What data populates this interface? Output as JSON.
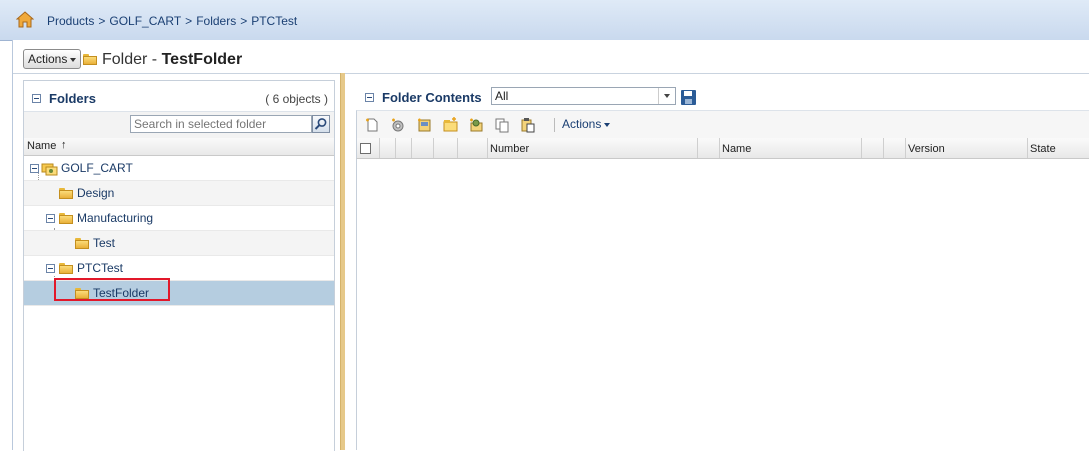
{
  "breadcrumb": {
    "items": [
      "Products",
      "GOLF_CART",
      "Folders",
      "PTCTest"
    ],
    "separator": ">"
  },
  "page_header": {
    "actions_label": "Actions",
    "title_prefix": "Folder - ",
    "title_name": "TestFolder"
  },
  "folders_panel": {
    "title": "Folders",
    "count": "( 6 objects )",
    "search_placeholder": "Search in selected folder",
    "column_name": "Name",
    "sort_indicator": "↑",
    "tree": [
      {
        "label": "GOLF_CART",
        "selected": false
      },
      {
        "label": "Design",
        "selected": false
      },
      {
        "label": "Manufacturing",
        "selected": false
      },
      {
        "label": "Test",
        "selected": false
      },
      {
        "label": "PTCTest",
        "selected": false
      },
      {
        "label": "TestFolder",
        "selected": true
      }
    ]
  },
  "contents_panel": {
    "title": "Folder Contents",
    "view_value": "All",
    "toolbar_actions_label": "Actions",
    "columns": [
      "Number",
      "Name",
      "Version",
      "State"
    ]
  },
  "colors": {
    "link": "#1a3f73",
    "selected_row": "#b5cde0",
    "highlight_box": "#e2182a",
    "splitter": "#e6c98a"
  }
}
